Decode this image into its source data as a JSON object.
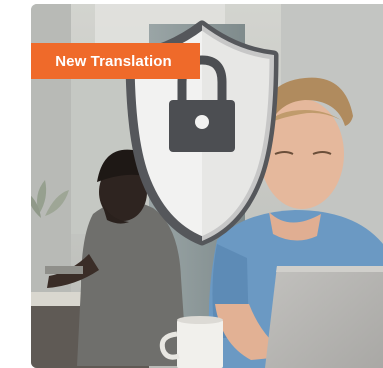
{
  "card": {
    "badge_label": "New Translation",
    "icon": "shield-lock-icon",
    "colors": {
      "badge": "#ef6a2a",
      "shield_outline": "#55575b",
      "lock": "#4c4e52"
    }
  }
}
